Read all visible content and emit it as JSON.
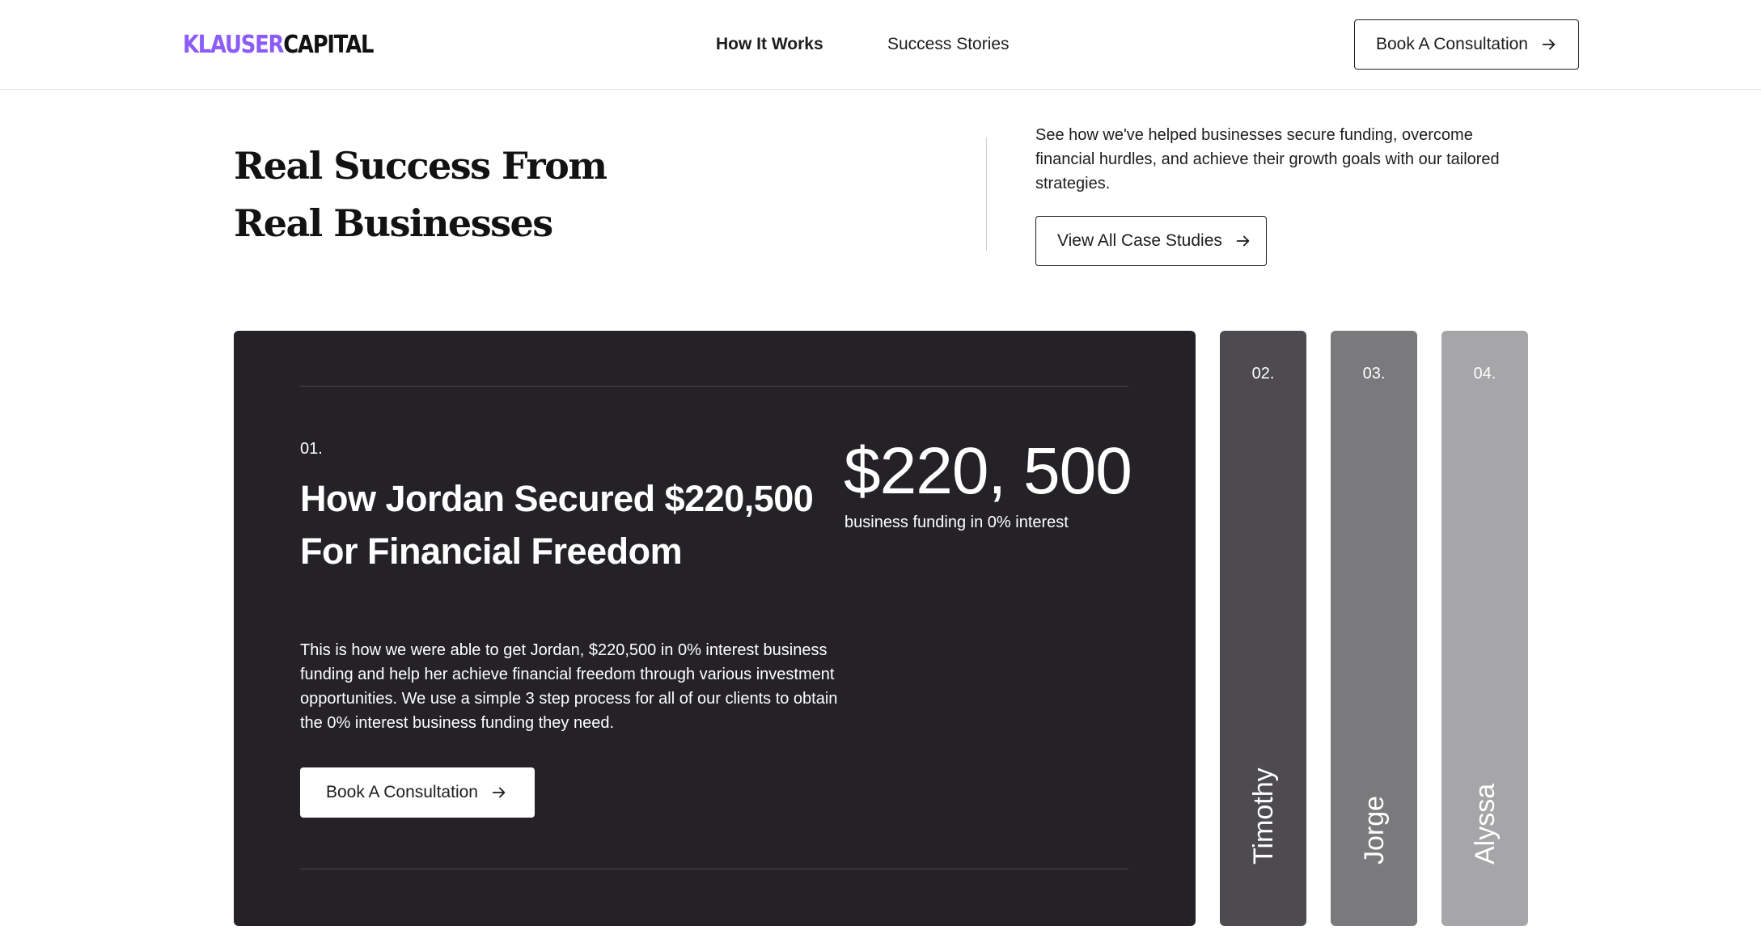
{
  "header": {
    "logo_primary": "KLAUSER",
    "logo_secondary": "CAPITAL",
    "nav": [
      {
        "label": "How It Works"
      },
      {
        "label": "Success Stories"
      }
    ],
    "cta_label": "Book A Consultation"
  },
  "intro": {
    "title_line1": "Real Success From",
    "title_line2": "Real Businesses",
    "description": "See how we've helped businesses secure funding, overcome financial hurdles, and achieve their growth goals with our tailored strategies.",
    "cases_button_label": "View All Case Studies"
  },
  "featured": {
    "number": "01.",
    "title": "How Jordan Secured $220,500 For Financial Freedom",
    "amount": "$220, 500",
    "amount_label": "business funding in 0% interest",
    "description": "This is how we were able to get Jordan, $220,500 in 0% interest business funding and help her achieve financial freedom through various investment opportunities. We use a simple 3 step process for all of our clients to obtain the 0% interest business funding they need.",
    "cta_label": "Book A Consultation"
  },
  "tabs": [
    {
      "number": "02.",
      "name": "Timothy"
    },
    {
      "number": "03.",
      "name": "Jorge"
    },
    {
      "number": "04.",
      "name": "Alyssa"
    }
  ],
  "colors": {
    "accent": "#8b5cf6",
    "card_bg": "#242226",
    "tab_02": "#4d4b4f",
    "tab_03": "#7a797c",
    "tab_04": "#a6a5a8"
  },
  "icons": {
    "button_arrow": "arrow-right-icon"
  }
}
